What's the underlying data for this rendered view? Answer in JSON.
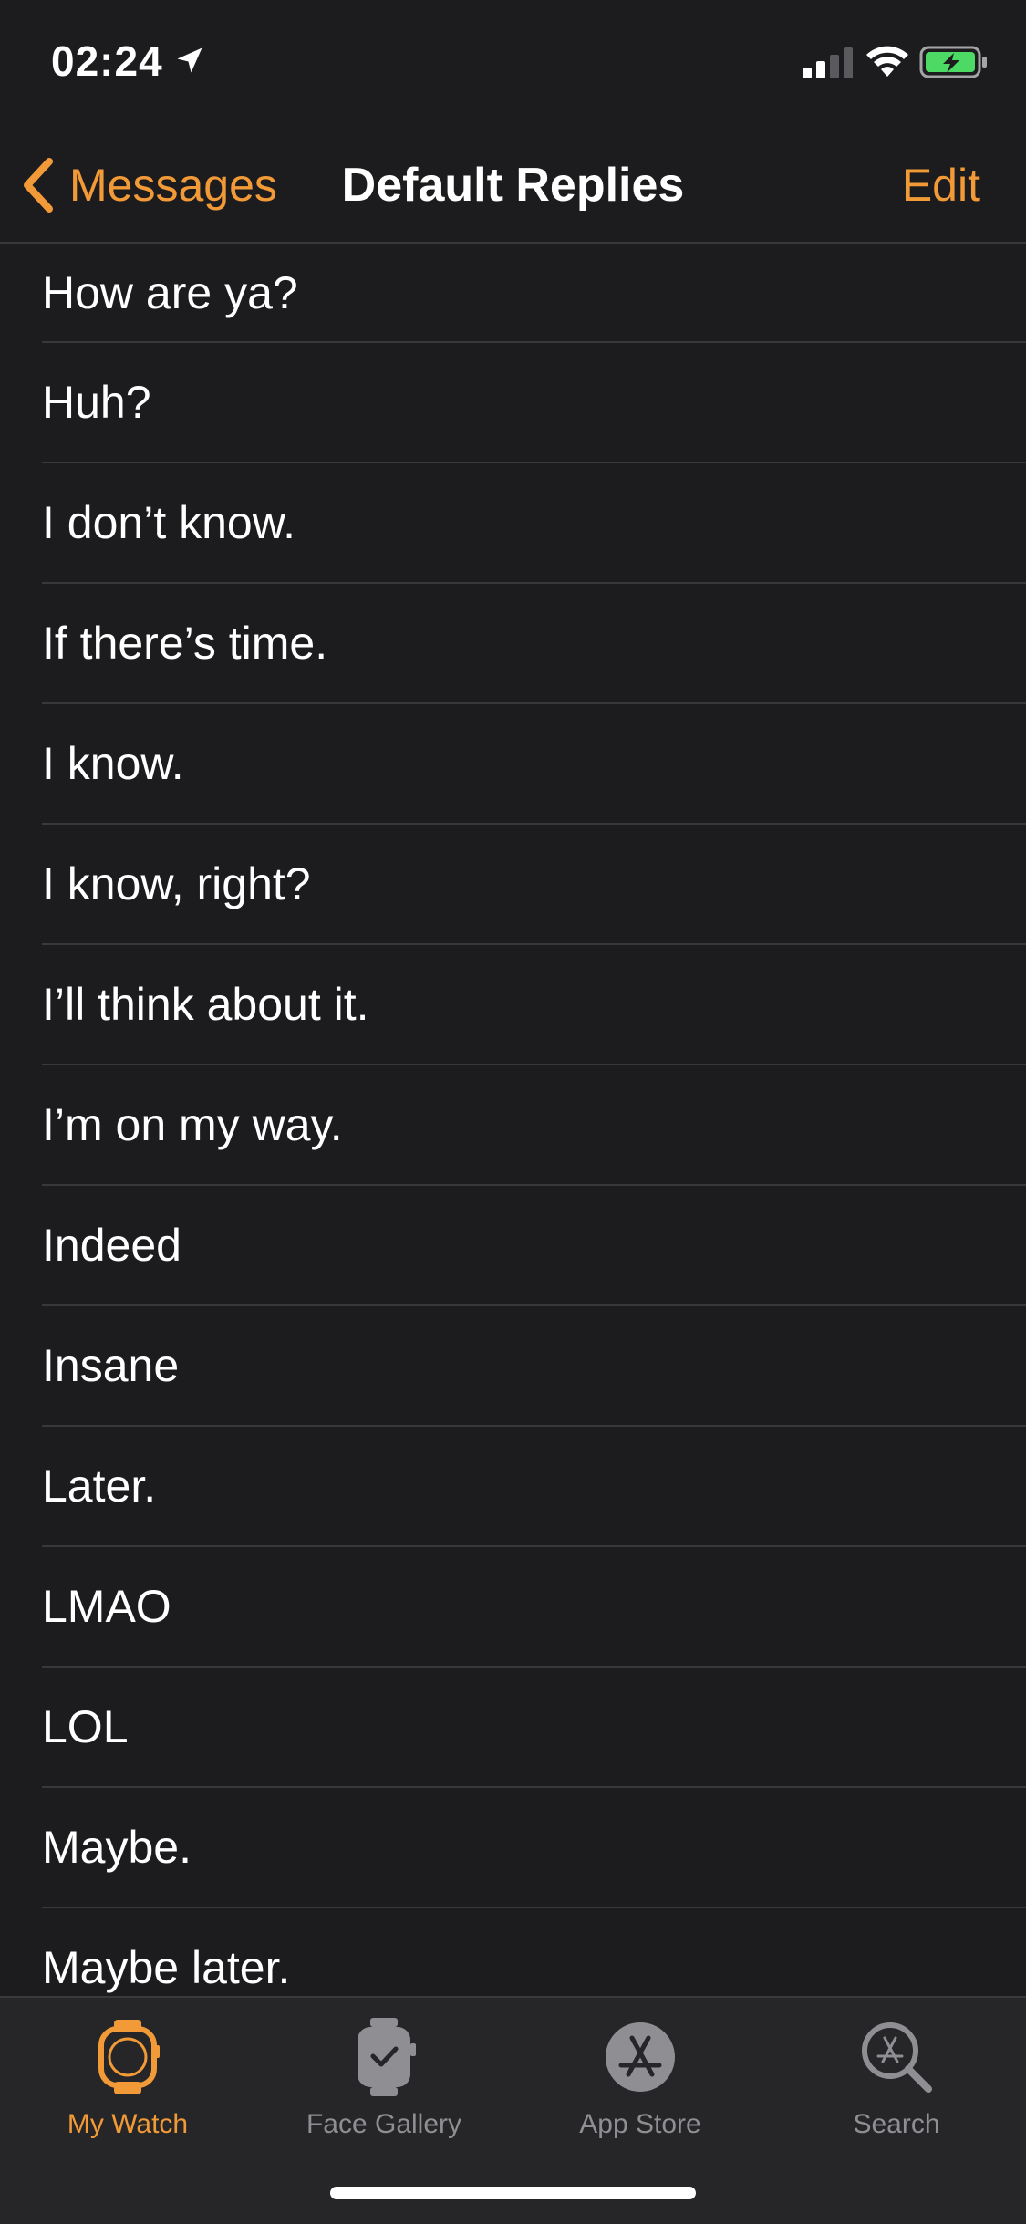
{
  "status_bar": {
    "time": "02:24"
  },
  "nav": {
    "back_label": "Messages",
    "title": "Default Replies",
    "edit_label": "Edit"
  },
  "replies": [
    "How are ya?",
    "Huh?",
    "I don’t know.",
    "If there’s time.",
    "I know.",
    "I know, right?",
    "I’ll think about it.",
    "I’m on my way.",
    "Indeed",
    "Insane",
    "Later.",
    "LMAO",
    "LOL",
    "Maybe.",
    "Maybe later."
  ],
  "tabs": [
    {
      "label": "My Watch",
      "icon": "watch-icon",
      "active": true
    },
    {
      "label": "Face Gallery",
      "icon": "face-gallery-icon",
      "active": false
    },
    {
      "label": "App Store",
      "icon": "app-store-icon",
      "active": false
    },
    {
      "label": "Search",
      "icon": "search-icon",
      "active": false
    }
  ],
  "colors": {
    "accent": "#f19a37",
    "background": "#1c1c1e",
    "separator": "#38383a",
    "inactive": "#8e8e93",
    "battery_fill": "#4cd964"
  }
}
